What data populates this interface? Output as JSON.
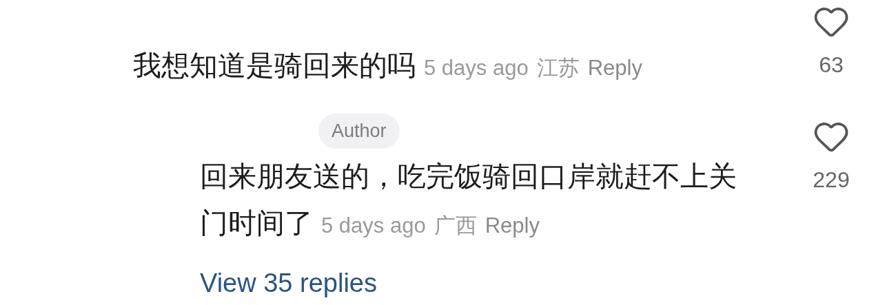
{
  "comments": [
    {
      "text": "我想知道是骑回来的吗",
      "time": "5 days ago",
      "location": "江苏",
      "reply_label": "Reply",
      "likes": "63",
      "liked": false,
      "replies": [
        {
          "badge": "Author",
          "text": "回来朋友送的，吃完饭骑回口岸就赶不上关门时间了",
          "time": "5 days ago",
          "location": "广西",
          "reply_label": "Reply",
          "likes": "229",
          "liked": false
        }
      ],
      "view_replies": "View 35 replies"
    }
  ]
}
